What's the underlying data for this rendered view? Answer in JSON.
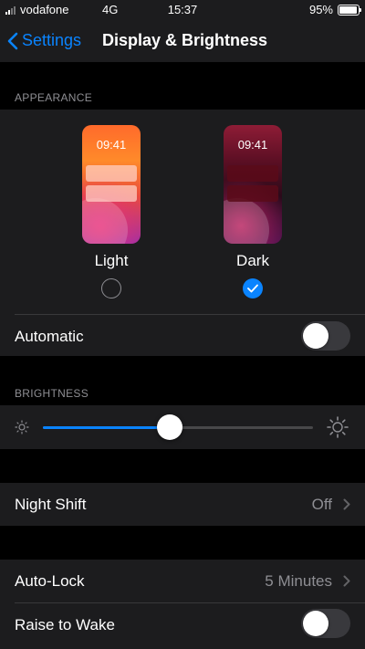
{
  "status_bar": {
    "carrier": "vodafone",
    "network": "4G",
    "time": "15:37",
    "battery_percent": "95%",
    "battery_level": 0.95
  },
  "nav": {
    "back_label": "Settings",
    "title": "Display & Brightness"
  },
  "appearance": {
    "header": "APPEARANCE",
    "light": {
      "label": "Light",
      "preview_time": "09:41",
      "selected": false
    },
    "dark": {
      "label": "Dark",
      "preview_time": "09:41",
      "selected": true
    },
    "automatic_label": "Automatic",
    "automatic_on": false
  },
  "brightness": {
    "header": "BRIGHTNESS",
    "level": 0.47,
    "min_icon": "sun-small-icon",
    "max_icon": "sun-large-icon"
  },
  "night_shift": {
    "label": "Night Shift",
    "value": "Off"
  },
  "auto_lock": {
    "label": "Auto-Lock",
    "value": "5 Minutes"
  },
  "raise_to_wake": {
    "label": "Raise to Wake",
    "on": false
  },
  "colors": {
    "accent": "#0a84ff",
    "background": "#000000",
    "cell": "#1c1c1e",
    "secondary_text": "#8e8e93"
  }
}
